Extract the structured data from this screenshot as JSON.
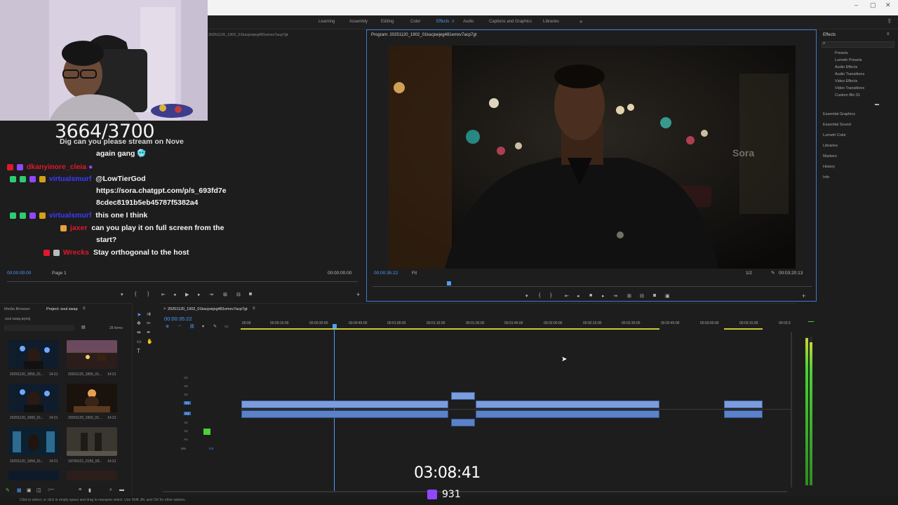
{
  "window": {
    "controls": [
      "–",
      "▢",
      "✕"
    ]
  },
  "workspace_tabs": [
    {
      "label": "Learning",
      "active": false
    },
    {
      "label": "Assembly",
      "active": false
    },
    {
      "label": "Editing",
      "active": false
    },
    {
      "label": "Color",
      "active": false
    },
    {
      "label": "Effects",
      "active": true
    },
    {
      "label": "Audio",
      "active": false
    },
    {
      "label": "Captions and Graphics",
      "active": false
    },
    {
      "label": "Libraries",
      "active": false
    }
  ],
  "stream": {
    "sub_counter": "3664/3700",
    "timer": "03:08:41",
    "viewer_count": "931"
  },
  "chat": [
    {
      "user": "",
      "text": "Dig can you please stream on Nove",
      "color": "#f5f5f5"
    },
    {
      "user": "",
      "text": "again gang 🥶",
      "color": "#f5f5f5"
    },
    {
      "user": "dkanyinore_cleia",
      "text": "",
      "color": "#e0182c"
    },
    {
      "user": "virtualsmurf",
      "text": "@LowTierGod",
      "color": "#3b3bff"
    },
    {
      "user": "",
      "text": "https://sora.chatgpt.com/p/s_693fd7e",
      "color": "#f5f5f5"
    },
    {
      "user": "",
      "text": "8cdec8191b5eb45787f5382a4",
      "color": "#f5f5f5"
    },
    {
      "user": "virtualsmurf",
      "text": "this one I think",
      "color": "#3b3bff"
    },
    {
      "user": "jaxer",
      "text": "can you play it on full screen from the",
      "color": "#e0182c"
    },
    {
      "user": "",
      "text": "start?",
      "color": "#f5f5f5"
    },
    {
      "user": "Wrecks",
      "text": "Stay orthogonal to the host",
      "color": "#e0182c"
    }
  ],
  "source_monitor": {
    "title": "20251120_1902_01kacjoejeg481emxv7acp7gt",
    "timecode_left": "00:00:00:00",
    "page": "Page 1",
    "timecode_right": "00:00:00:00"
  },
  "program_monitor": {
    "title": "Program: 20251120_1902_01kacjoejeg481emxv7acp7gt",
    "timecode": "00:00:35:22",
    "fit": "Fit",
    "resolution": "1/2",
    "duration": "00:03:20:13",
    "watermark": "Sora"
  },
  "effects_panel": {
    "title": "Effects",
    "items": [
      "Presets",
      "Lumetri Presets",
      "Audio Effects",
      "Audio Transitions",
      "Video Effects",
      "Video Transitions",
      "Custom Bin 01"
    ],
    "sections": [
      "Essential Graphics",
      "Essential Sound",
      "Lumetri Color",
      "Libraries",
      "Markers",
      "History",
      "Info"
    ]
  },
  "project_panel": {
    "tabs": [
      "Media Browser",
      "Project: soul swap"
    ],
    "project_file": "soul swap.prproj",
    "item_count": "28 items",
    "thumbnails": [
      {
        "name": "20251120_1856_01...",
        "dur": "14:21"
      },
      {
        "name": "20251120_1856_01...",
        "dur": "14:21"
      },
      {
        "name": "20251120_1900_01...",
        "dur": "14:21"
      },
      {
        "name": "20251120_1902_01...",
        "dur": "14:21"
      },
      {
        "name": "20251120_1954_01...",
        "dur": "14:21"
      },
      {
        "name": "19700121_0155_69...",
        "dur": "14:21"
      }
    ]
  },
  "timeline": {
    "sequence_tab": "20251120_1902_01kacjoejeg481emxv7acp7gt",
    "playhead_timecode": "00:00:35:22",
    "ruler": [
      "00:00",
      "00:00:15:00",
      "00:00:30:00",
      "00:00:45:00",
      "00:01:00:00",
      "00:01:15:00",
      "00:01:30:00",
      "00:01:45:00",
      "00:02:00:00",
      "00:02:15:00",
      "00:02:30:00",
      "00:02:45:00",
      "00:03:00:00",
      "00:03:15:00",
      "00:03:3"
    ],
    "video_tracks": [
      "V4",
      "V3",
      "V2",
      "V1"
    ],
    "audio_tracks": [
      "A1",
      "A2",
      "A3",
      "A4"
    ],
    "mix_label": "Mix",
    "mix_value": "0.0"
  },
  "status_text": "Click to select, or click in empty space and drag to marquee select. Use Shift, Alt, and Ctrl for other options.",
  "colors": {
    "accent": "#4f9bff",
    "panel_bg": "#1d1d1d",
    "clip_video": "#7b9ddb",
    "clip_audio": "#5b82c9",
    "meter_green": "#4cd137"
  }
}
